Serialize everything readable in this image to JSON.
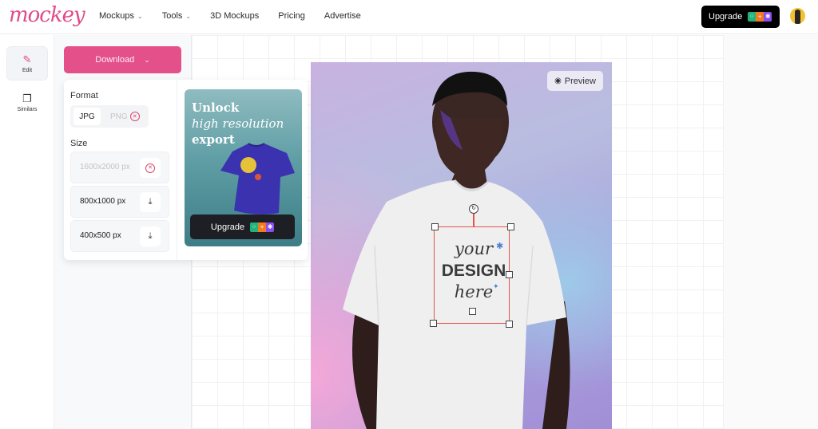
{
  "header": {
    "logo": "mockey",
    "nav": [
      {
        "label": "Mockups",
        "dropdown": true
      },
      {
        "label": "Tools",
        "dropdown": true
      },
      {
        "label": "3D Mockups",
        "dropdown": false
      },
      {
        "label": "Pricing",
        "dropdown": false
      },
      {
        "label": "Advertise",
        "dropdown": false
      }
    ],
    "upgrade_label": "Upgrade",
    "upgrade_badges": [
      "⁘",
      "+",
      "✱"
    ]
  },
  "rail": {
    "items": [
      {
        "label": "Edit",
        "icon": "pencil-icon",
        "active": true
      },
      {
        "label": "Similars",
        "icon": "similars-icon",
        "active": false
      }
    ]
  },
  "download": {
    "button_label": "Download",
    "format_label": "Format",
    "formats": [
      {
        "label": "JPG",
        "selected": true,
        "locked": false
      },
      {
        "label": "PNG",
        "selected": false,
        "locked": true
      }
    ],
    "size_label": "Size",
    "sizes": [
      {
        "label": "1600x2000 px",
        "locked": true
      },
      {
        "label": "800x1000 px",
        "locked": false
      },
      {
        "label": "400x500 px",
        "locked": false
      }
    ]
  },
  "promo": {
    "line1": "Unlock",
    "line2": "high resolution",
    "line3": "export",
    "button_label": "Upgrade"
  },
  "canvas": {
    "preview_label": "Preview",
    "design_placeholder": {
      "line1": "your",
      "line2": "DESIGN",
      "line3": "here"
    }
  },
  "colors": {
    "brand": "#e4508a",
    "selection": "#e5534b"
  }
}
